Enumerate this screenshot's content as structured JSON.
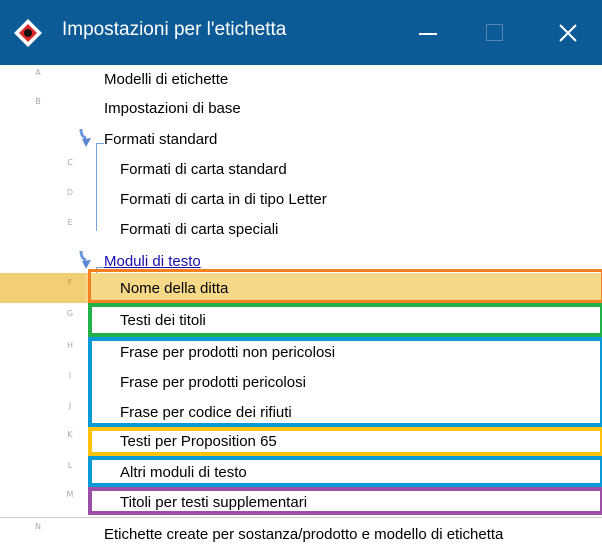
{
  "window": {
    "title": "Impostazioni per l'etichetta"
  },
  "tree": {
    "items": [
      {
        "letter": "A",
        "label": "Modelli di etichette"
      },
      {
        "letter": "B",
        "label": "Impostazioni di base"
      },
      {
        "label": "Formati standard"
      },
      {
        "letter": "C",
        "label": "Formati di carta standard"
      },
      {
        "letter": "D",
        "label": "Formati di carta in di tipo Letter"
      },
      {
        "letter": "E",
        "label": "Formati di carta speciali"
      },
      {
        "label": "Moduli di testo"
      },
      {
        "letter": "F",
        "label": "Nome della ditta"
      },
      {
        "letter": "G",
        "label": "Testi dei titoli"
      },
      {
        "letter": "H",
        "label": "Frase per prodotti non pericolosi"
      },
      {
        "letter": "I",
        "label": "Frase per prodotti pericolosi"
      },
      {
        "letter": "J",
        "label": "Frase per codice dei rifiuti"
      },
      {
        "letter": "K",
        "label": "Testi per Proposition 65"
      },
      {
        "letter": "L",
        "label": "Altri moduli di testo"
      },
      {
        "letter": "M",
        "label": "Titoli per testi supplementari"
      },
      {
        "letter": "N",
        "label": "Etichette create per sostanza/prodotto e modello di etichetta"
      }
    ]
  },
  "colors": {
    "titlebar": "#0c5a96",
    "selection": "#f5d989",
    "highlight_orange": "#f4801f",
    "highlight_green": "#22b04b",
    "highlight_blue": "#0a9ad8",
    "highlight_yellow": "#ffc20e",
    "highlight_purple": "#9b4fa5"
  },
  "icons": [
    "app-diamond-icon",
    "minimize-icon",
    "maximize-icon",
    "close-icon",
    "expand-arrow-icon"
  ]
}
